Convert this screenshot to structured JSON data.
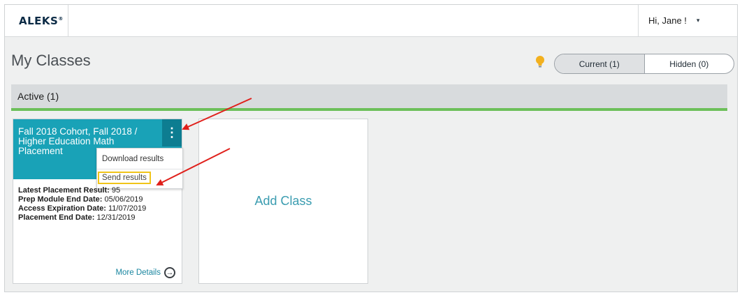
{
  "app": {
    "logo": "ALEKS",
    "logo_mark": "®"
  },
  "user": {
    "greeting": "Hi, Jane !",
    "caret": "▾"
  },
  "page": {
    "title": "My Classes"
  },
  "tabs": {
    "current": "Current (1)",
    "hidden": "Hidden (0)"
  },
  "section": {
    "label": "Active (1)"
  },
  "class_card": {
    "title": "Fall 2018 Cohort, Fall 2018 / Higher Education Math Placement",
    "menu_icon": "⋮",
    "menu": {
      "download": "Download results",
      "send": "Send results"
    },
    "details": [
      {
        "label": "Latest Placement Result:",
        "value": "95"
      },
      {
        "label": "Prep Module End Date:",
        "value": "05/06/2019"
      },
      {
        "label": "Access Expiration Date:",
        "value": "11/07/2019"
      },
      {
        "label": "Placement End Date:",
        "value": "12/31/2019"
      }
    ],
    "more": "More Details",
    "more_icon": "→"
  },
  "add_class": {
    "label": "Add Class"
  },
  "colors": {
    "teal": "#19a2b7",
    "teal_dark": "#0d7d91",
    "green_rule": "#6cbf5a",
    "highlight": "#f0c419",
    "arrow": "#e0201b"
  }
}
